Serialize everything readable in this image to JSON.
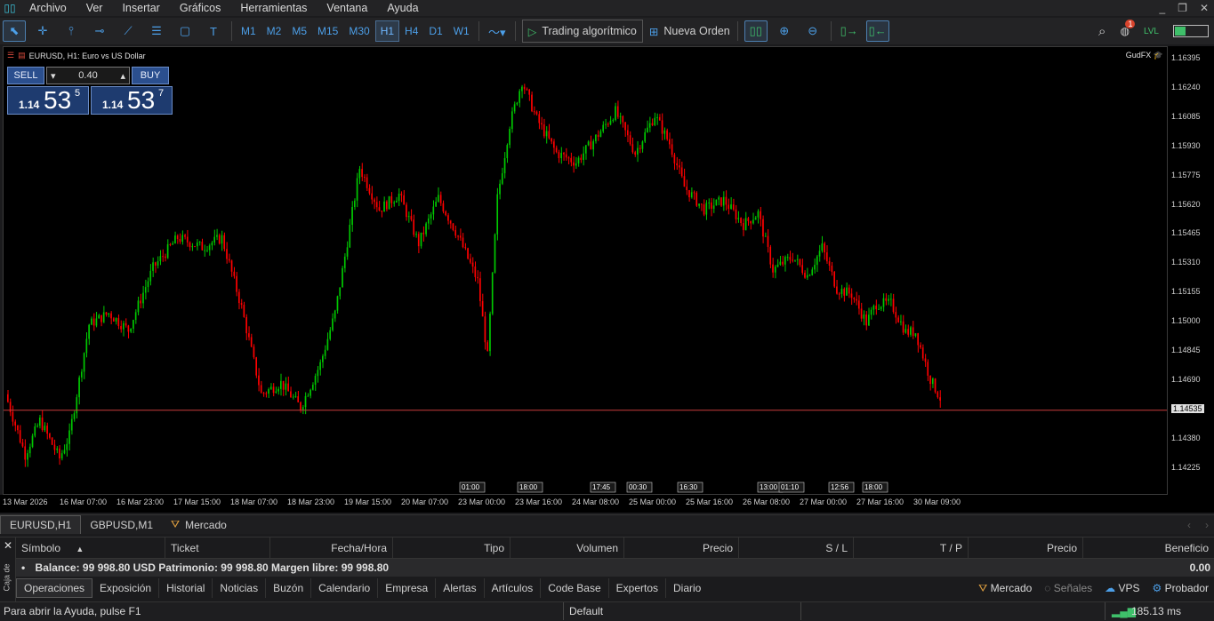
{
  "menu": {
    "items": [
      "Archivo",
      "Ver",
      "Insertar",
      "Gráficos",
      "Herramientas",
      "Ventana",
      "Ayuda"
    ]
  },
  "toolbar": {
    "timeframes": [
      "M1",
      "M2",
      "M5",
      "M15",
      "M30",
      "H1",
      "H4",
      "D1",
      "W1"
    ],
    "active_timeframe": "H1",
    "algo_label": "Trading algorítmico",
    "order_label": "Nueva Orden",
    "notification_count": "1"
  },
  "chart": {
    "title": "EURUSD, H1:  Euro vs US Dollar",
    "provider": "GudFX",
    "lot": "0.40",
    "sell_label": "SELL",
    "buy_label": "BUY",
    "sell_price": {
      "big": "1.14",
      "main": "53",
      "small": "5"
    },
    "buy_price": {
      "big": "1.14",
      "main": "53",
      "small": "7"
    },
    "current_price": "1.14535",
    "price_labels": [
      "1.16395",
      "1.16240",
      "1.16085",
      "1.15930",
      "1.15775",
      "1.15620",
      "1.15465",
      "1.15310",
      "1.15155",
      "1.15000",
      "1.14845",
      "1.14690",
      "1.14535",
      "1.14380",
      "1.14225"
    ],
    "time_labels": [
      "13 Mar 2026",
      "16 Mar 07:00",
      "16 Mar 23:00",
      "17 Mar 15:00",
      "18 Mar 07:00",
      "18 Mar 23:00",
      "19 Mar 15:00",
      "20 Mar 07:00",
      "23 Mar 00:00",
      "23 Mar 16:00",
      "24 Mar 08:00",
      "25 Mar 00:00",
      "25 Mar 16:00",
      "26 Mar 08:00",
      "27 Mar 00:00",
      "27 Mar 16:00",
      "30 Mar 09:00"
    ],
    "event_labels": [
      "01:00",
      "18:00",
      "17:45",
      "00:30",
      "16:30",
      "13:00",
      "01:10",
      "12:56",
      "18:00"
    ],
    "colors": {
      "bull": "#00c800",
      "bear": "#ff0000",
      "price_line": "#c83c3c"
    }
  },
  "chart_tabs": [
    "EURUSD,H1",
    "GBPUSD,M1",
    "Mercado"
  ],
  "toolbox": {
    "side_label": "Caja de",
    "columns": [
      "Símbolo",
      "Ticket",
      "Fecha/Hora",
      "Tipo",
      "Volumen",
      "Precio",
      "S / L",
      "T / P",
      "Precio",
      "Beneficio"
    ],
    "balance_text": "Balance: 99 998.80 USD  Patrimonio: 99 998.80  Margen libre: 99 998.80",
    "profit": "0.00",
    "tabs": [
      "Operaciones",
      "Exposición",
      "Historial",
      "Noticias",
      "Buzón",
      "Calendario",
      "Empresa",
      "Alertas",
      "Artículos",
      "Code Base",
      "Expertos",
      "Diario"
    ],
    "right_tabs": [
      "Mercado",
      "Señales",
      "VPS",
      "Probador"
    ]
  },
  "status": {
    "help": "Para abrir la Ayuda, pulse F1",
    "profile": "Default",
    "ping": "185.13 ms"
  }
}
